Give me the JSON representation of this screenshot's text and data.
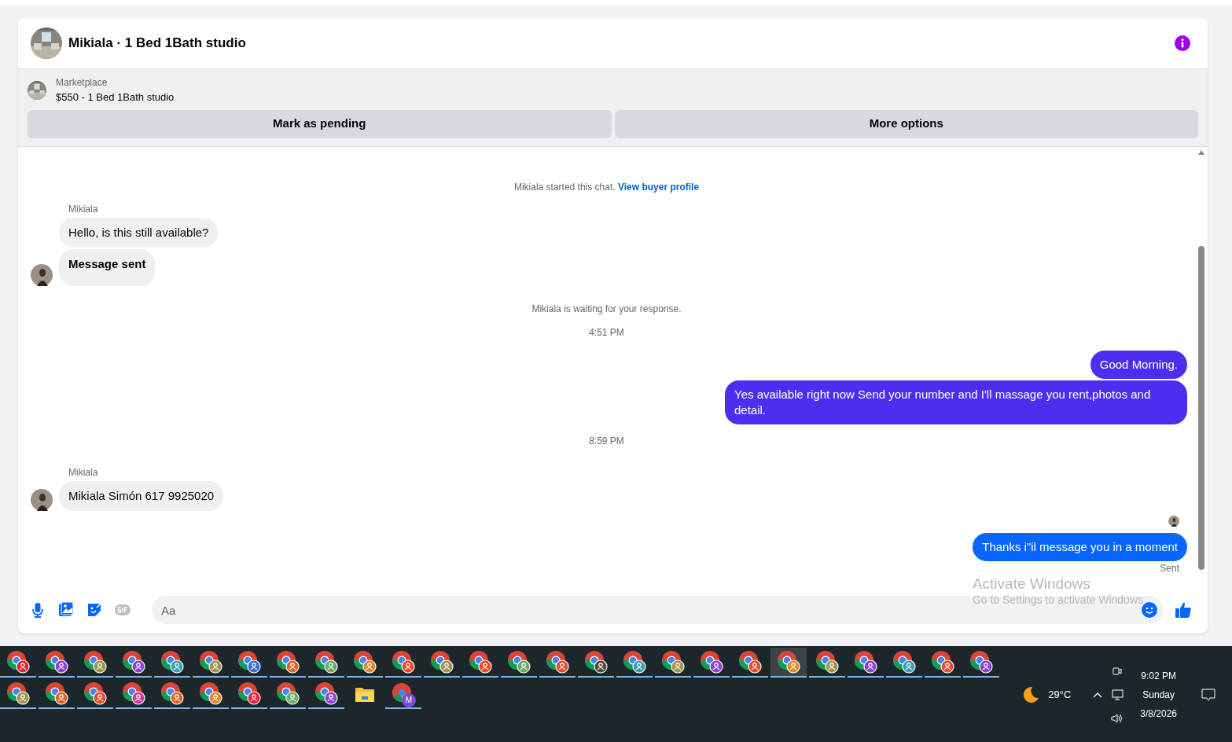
{
  "header": {
    "title": "Mikiala · 1 Bed 1Bath studio"
  },
  "listing": {
    "label": "Marketplace",
    "title": "$550 - 1 Bed 1Bath studio"
  },
  "actions": [
    "Mark as pending",
    "More options"
  ],
  "messages": [
    {
      "kind": "notice",
      "text": "Mikiala started this chat.",
      "link": "View buyer profile"
    },
    {
      "kind": "sender",
      "text": "Mikiala"
    },
    {
      "kind": "incoming",
      "text": "Hello, is this still available?",
      "avatar": false
    },
    {
      "kind": "incoming",
      "text": "Message sent",
      "avatar": true,
      "bold": true
    },
    {
      "kind": "notice",
      "text": "Mikiala is waiting for your response."
    },
    {
      "kind": "time",
      "text": "4:51 PM"
    },
    {
      "kind": "outgoing",
      "text": "Good Morning.",
      "color": "#4a2ff0"
    },
    {
      "kind": "outgoing",
      "text": "Yes available right now Send your number and I'll massage you rent,photos and detail.",
      "color": "#4a2ff0"
    },
    {
      "kind": "time",
      "text": "8:59 PM"
    },
    {
      "kind": "sender",
      "text": "Mikiala"
    },
    {
      "kind": "incoming",
      "text": "Mikiala Simón 617 9925020",
      "avatar": true
    },
    {
      "kind": "seen"
    },
    {
      "kind": "outgoing",
      "text": "Thanks i\"il message you in a moment",
      "color": "#0866ff"
    },
    {
      "kind": "status",
      "text": "Sent"
    }
  ],
  "composer": {
    "placeholder": "Aa"
  },
  "overlay": {
    "title": "Activate Windows",
    "subtitle": "Go to Settings to activate Windows"
  },
  "taskbar": {
    "rows": [
      [
        {
          "kind": "chrome",
          "color": "#e8213a",
          "selected": false
        },
        {
          "kind": "chrome",
          "color": "#8e44d0",
          "selected": false
        },
        {
          "kind": "chrome",
          "color": "#a09450",
          "selected": false
        },
        {
          "kind": "chrome",
          "color": "#8e44d0",
          "selected": false
        },
        {
          "kind": "chrome",
          "color": "#3aa0b0",
          "selected": false
        },
        {
          "kind": "chrome",
          "color": "#a09450",
          "selected": false
        },
        {
          "kind": "chrome",
          "color": "#3a6fd0",
          "selected": false
        },
        {
          "kind": "chrome",
          "color": "#e0652a",
          "selected": false
        },
        {
          "kind": "chrome",
          "color": "#6fa86a",
          "selected": false
        },
        {
          "kind": "chrome",
          "color": "#e08a2a",
          "selected": false
        },
        {
          "kind": "chrome",
          "color": "#e84a2a",
          "selected": false
        },
        {
          "kind": "chrome",
          "color": "#a09450",
          "selected": false
        },
        {
          "kind": "chrome",
          "color": "#e84a2a",
          "selected": false
        },
        {
          "kind": "chrome",
          "color": "#6fa86a",
          "selected": false
        },
        {
          "kind": "chrome",
          "color": "#e84a2a",
          "selected": false
        },
        {
          "kind": "chrome",
          "color": "#5a4a3a",
          "selected": false
        },
        {
          "kind": "chrome",
          "color": "#3aa0b0",
          "selected": false
        },
        {
          "kind": "chrome",
          "color": "#a09450",
          "selected": false
        },
        {
          "kind": "chrome",
          "color": "#8e44d0",
          "selected": false
        },
        {
          "kind": "chrome",
          "color": "#e84a2a",
          "selected": false
        },
        {
          "kind": "chrome",
          "color": "#e08a2a",
          "selected": true
        },
        {
          "kind": "chrome",
          "color": "#a09450",
          "selected": false
        },
        {
          "kind": "chrome",
          "color": "#8e44d0",
          "selected": false
        },
        {
          "kind": "chrome",
          "color": "#3aa0b0",
          "selected": false
        },
        {
          "kind": "chrome",
          "color": "#e84a2a",
          "selected": false
        },
        {
          "kind": "chrome",
          "color": "#8e44d0",
          "selected": false
        }
      ],
      [
        {
          "kind": "chrome",
          "color": "#a09450",
          "selected": false
        },
        {
          "kind": "chrome",
          "color": "#e0652a",
          "selected": false
        },
        {
          "kind": "chrome",
          "color": "#e84a2a",
          "selected": false
        },
        {
          "kind": "chrome",
          "color": "#d03a9a",
          "selected": false
        },
        {
          "kind": "chrome",
          "color": "#e0652a",
          "selected": false
        },
        {
          "kind": "chrome",
          "color": "#e08a2a",
          "selected": false
        },
        {
          "kind": "chrome",
          "color": "#e8213a",
          "selected": false
        },
        {
          "kind": "chrome",
          "color": "#6fa86a",
          "selected": false
        },
        {
          "kind": "chrome",
          "color": "#8e44d0",
          "selected": false
        },
        {
          "kind": "folder",
          "selected": false
        },
        {
          "kind": "letter",
          "label": "M",
          "color": "#7a4ad0",
          "selected": false
        }
      ]
    ],
    "weather": "29°C",
    "time": "9:02 PM",
    "day": "Sunday",
    "date": "3/8/2026"
  }
}
